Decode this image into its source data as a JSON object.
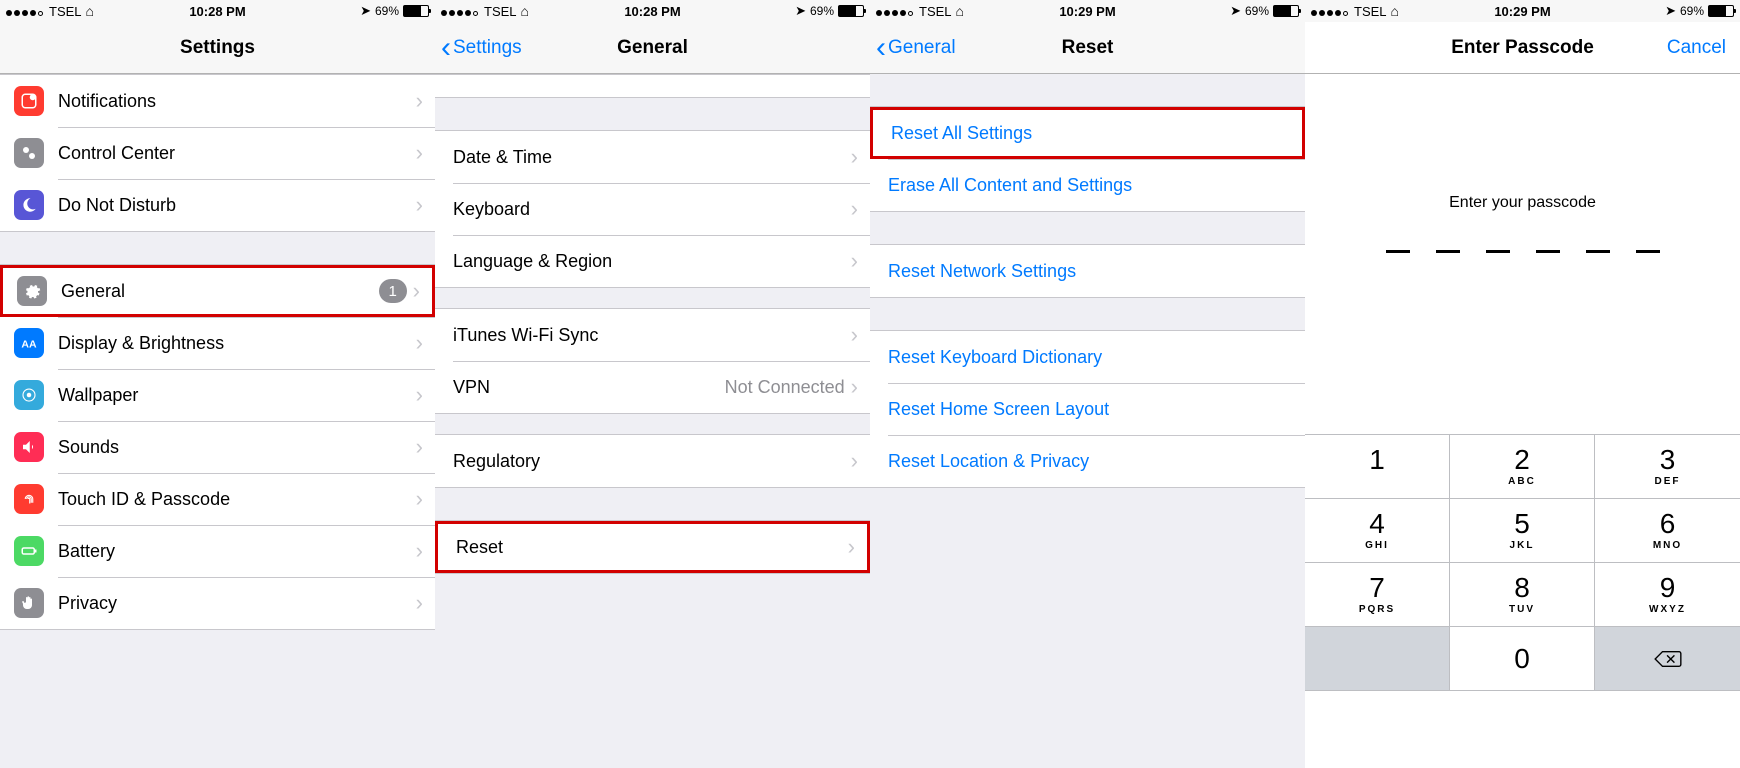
{
  "status": {
    "carrier": "TSEL",
    "battery": "69%"
  },
  "times": {
    "p1": "10:28 PM",
    "p2": "10:28 PM",
    "p3": "10:29 PM",
    "p4": "10:29 PM"
  },
  "p1": {
    "title": "Settings",
    "rows1": [
      {
        "label": "Notifications",
        "icon": "notify",
        "color": "#ff3b30"
      },
      {
        "label": "Control Center",
        "icon": "control",
        "color": "#8e8e93"
      },
      {
        "label": "Do Not Disturb",
        "icon": "moon",
        "color": "#5856d6"
      }
    ],
    "rows2": [
      {
        "label": "General",
        "icon": "gear",
        "color": "#8e8e93",
        "badge": "1",
        "highlight": true
      },
      {
        "label": "Display & Brightness",
        "icon": "display",
        "color": "#007aff"
      },
      {
        "label": "Wallpaper",
        "icon": "wallpaper",
        "color": "#34aadc"
      },
      {
        "label": "Sounds",
        "icon": "sounds",
        "color": "#ff2d55"
      },
      {
        "label": "Touch ID & Passcode",
        "icon": "touchid",
        "color": "#ff3b30"
      },
      {
        "label": "Battery",
        "icon": "battery",
        "color": "#4cd964"
      },
      {
        "label": "Privacy",
        "icon": "hand",
        "color": "#8e8e93"
      }
    ]
  },
  "p2": {
    "back": "Settings",
    "title": "General",
    "g1": [
      {
        "label": "Date & Time"
      },
      {
        "label": "Keyboard"
      },
      {
        "label": "Language & Region"
      }
    ],
    "g2": [
      {
        "label": "iTunes Wi-Fi Sync"
      },
      {
        "label": "VPN",
        "detail": "Not Connected"
      }
    ],
    "g3": [
      {
        "label": "Regulatory"
      }
    ],
    "g4": [
      {
        "label": "Reset",
        "highlight": true
      }
    ]
  },
  "p3": {
    "back": "General",
    "title": "Reset",
    "g1": [
      {
        "label": "Reset All Settings",
        "highlight": true
      },
      {
        "label": "Erase All Content and Settings"
      }
    ],
    "g2": [
      {
        "label": "Reset Network Settings"
      }
    ],
    "g3": [
      {
        "label": "Reset Keyboard Dictionary"
      },
      {
        "label": "Reset Home Screen Layout"
      },
      {
        "label": "Reset Location & Privacy"
      }
    ]
  },
  "p4": {
    "title": "Enter Passcode",
    "cancel": "Cancel",
    "prompt": "Enter your passcode",
    "keys": [
      {
        "n": "1",
        "l": ""
      },
      {
        "n": "2",
        "l": "ABC"
      },
      {
        "n": "3",
        "l": "DEF"
      },
      {
        "n": "4",
        "l": "GHI"
      },
      {
        "n": "5",
        "l": "JKL"
      },
      {
        "n": "6",
        "l": "MNO"
      },
      {
        "n": "7",
        "l": "PQRS"
      },
      {
        "n": "8",
        "l": "TUV"
      },
      {
        "n": "9",
        "l": "WXYZ"
      }
    ],
    "zero": "0"
  }
}
